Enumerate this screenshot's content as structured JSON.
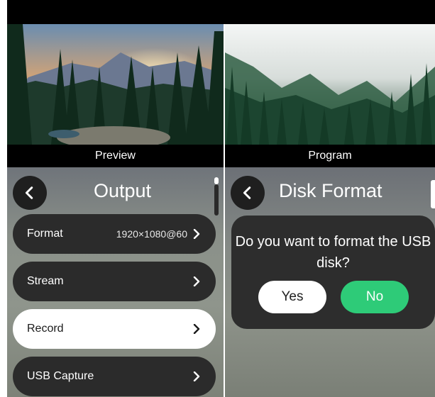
{
  "preview": {
    "label": "Preview"
  },
  "program": {
    "label": "Program"
  },
  "output_menu": {
    "title": "Output",
    "items": [
      {
        "label": "Format",
        "value": "1920×1080@60"
      },
      {
        "label": "Stream"
      },
      {
        "label": "Record"
      },
      {
        "label": "USB Capture"
      }
    ]
  },
  "disk_format": {
    "title": "Disk Format",
    "question": "Do you want to format the USB disk?",
    "yes_label": "Yes",
    "no_label": "No"
  },
  "colors": {
    "confirm_green": "#2ecb78",
    "panel_dark": "#2b2b2b",
    "active_item": "#ffffff"
  },
  "icons": [
    "chevron-left-icon",
    "chevron-right-icon"
  ]
}
